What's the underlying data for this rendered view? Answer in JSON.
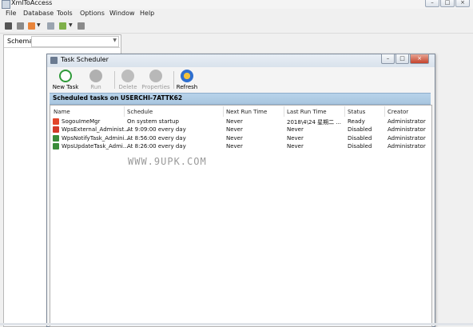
{
  "app": {
    "title": "XmlToAccess"
  },
  "window_controls": {
    "minimize": "–",
    "maximize": "□",
    "close": "×"
  },
  "menu": [
    "File",
    "Database",
    "Tools",
    "Options",
    "Window",
    "Help"
  ],
  "left_panel": {
    "schema_label": "Schema",
    "schema_value": ""
  },
  "dialog": {
    "title": "Task Scheduler",
    "toolbar": [
      {
        "label": "New Task",
        "enabled": true,
        "icon": "new-task-icon",
        "color": "#2f9a3a"
      },
      {
        "label": "Run",
        "enabled": false,
        "icon": "run-icon",
        "color": "#b0b0b0"
      },
      {
        "label": "Delete",
        "enabled": false,
        "icon": "delete-icon",
        "color": "#b0b0b0"
      },
      {
        "label": "Properties",
        "enabled": false,
        "icon": "properties-icon",
        "color": "#b0b0b0"
      },
      {
        "label": "Refresh",
        "enabled": true,
        "icon": "refresh-icon",
        "color": "#2f6fcf"
      }
    ],
    "scheduled_label": "Scheduled tasks on USERCHI-7ATTK62",
    "columns": [
      "Name",
      "Schedule",
      "Next Run Time",
      "Last Run Time",
      "Status",
      "Creator"
    ],
    "rows": [
      {
        "name": "SogouImeMgr",
        "schedule": "On system startup",
        "next": "Never",
        "last": "2018\\4\\24 星期二 ...",
        "status": "Ready",
        "creator": "Administrator",
        "icon_color": "#e2462b"
      },
      {
        "name": "WpsExternal_Administ...",
        "schedule": "At 9:09:00 every day",
        "next": "Never",
        "last": "Never",
        "status": "Disabled",
        "creator": "Administrator",
        "icon_color": "#d23a2a"
      },
      {
        "name": "WpsNotifyTask_Admini...",
        "schedule": "At 8:56:00 every day",
        "next": "Never",
        "last": "Never",
        "status": "Disabled",
        "creator": "Administrator",
        "icon_color": "#3a8c3a"
      },
      {
        "name": "WpsUpdateTask_Admi...",
        "schedule": "At 8:26:00 every day",
        "next": "Never",
        "last": "Never",
        "status": "Disabled",
        "creator": "Administrator",
        "icon_color": "#3a8c3a"
      }
    ]
  },
  "watermark": "WWW.9UPK.COM"
}
